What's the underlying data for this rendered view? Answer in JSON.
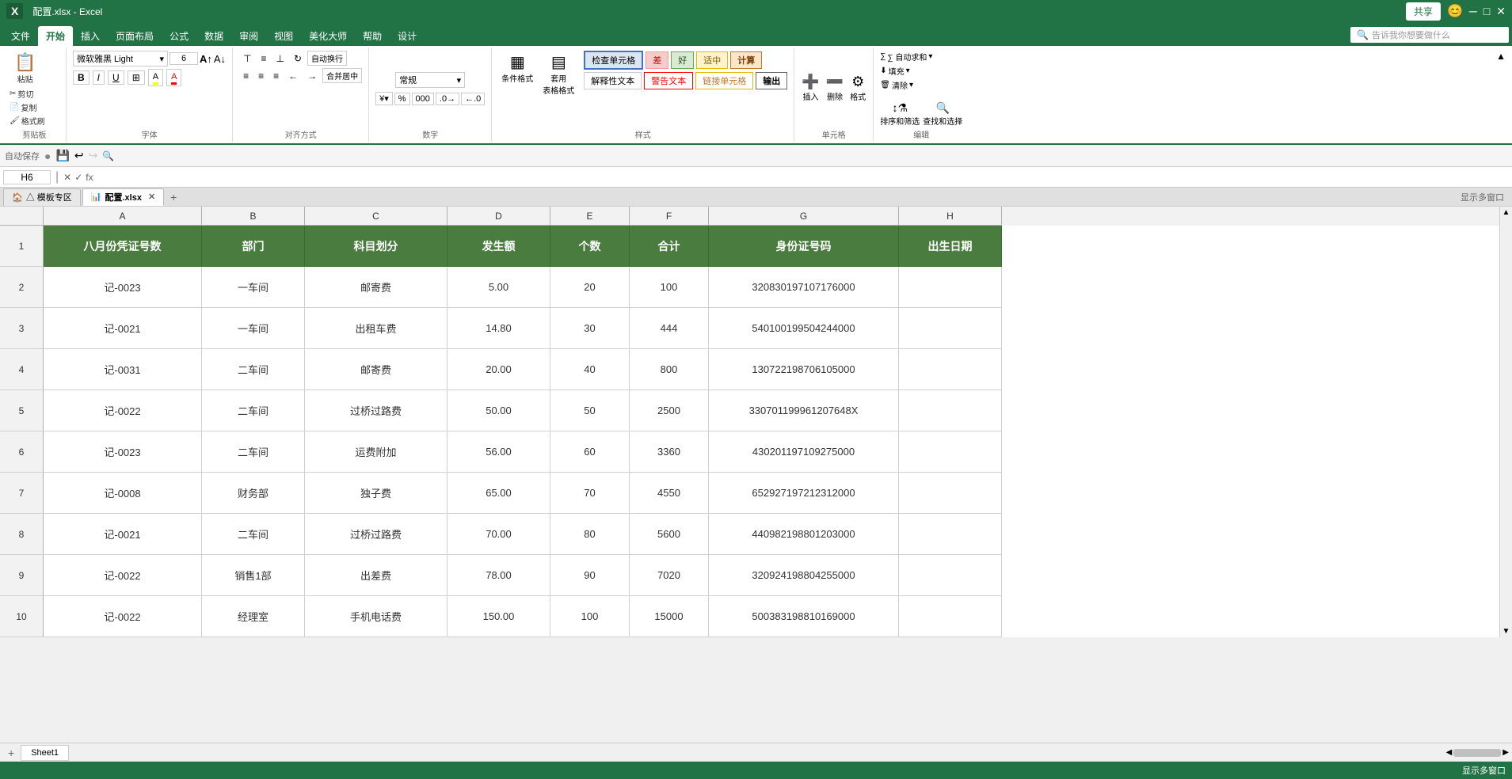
{
  "app": {
    "title": "配置.xlsx - Excel",
    "share_label": "共享",
    "emoji": "😊"
  },
  "ribbon_tabs": [
    {
      "label": "文件",
      "active": false
    },
    {
      "label": "开始",
      "active": true
    },
    {
      "label": "插入",
      "active": false
    },
    {
      "label": "页面布局",
      "active": false
    },
    {
      "label": "公式",
      "active": false
    },
    {
      "label": "数据",
      "active": false
    },
    {
      "label": "审阅",
      "active": false
    },
    {
      "label": "视图",
      "active": false
    },
    {
      "label": "美化大师",
      "active": false
    },
    {
      "label": "帮助",
      "active": false
    },
    {
      "label": "设计",
      "active": false
    }
  ],
  "search_placeholder": "告诉我你想要做什么",
  "quick_access": {
    "autosave_label": "自动保存",
    "autosave_off": "●"
  },
  "font": {
    "name": "微软雅黑 Light",
    "size": "6",
    "bold": "B",
    "italic": "I",
    "underline": "U"
  },
  "cell_ref": "H6",
  "formula_content": "",
  "file_tabs": [
    {
      "label": "△ 模板专区",
      "active": false,
      "icon": "🏠"
    },
    {
      "label": "配置.xlsx",
      "active": true,
      "icon": "📊",
      "closeable": true
    }
  ],
  "columns": [
    {
      "label": "A",
      "class": "col-a"
    },
    {
      "label": "B",
      "class": "col-b"
    },
    {
      "label": "C",
      "class": "col-c"
    },
    {
      "label": "D",
      "class": "col-d"
    },
    {
      "label": "E",
      "class": "col-e"
    },
    {
      "label": "F",
      "class": "col-f"
    },
    {
      "label": "G",
      "class": "col-g"
    },
    {
      "label": "H",
      "class": "col-h"
    }
  ],
  "rows": [
    {
      "row_num": "1",
      "height_class": "row-1",
      "is_header": true,
      "cells": [
        {
          "value": "八月份凭证号数",
          "class": "col-a header-row"
        },
        {
          "value": "部门",
          "class": "col-b header-row"
        },
        {
          "value": "科目划分",
          "class": "col-c header-row"
        },
        {
          "value": "发生额",
          "class": "col-d header-row"
        },
        {
          "value": "个数",
          "class": "col-e header-row"
        },
        {
          "value": "合计",
          "class": "col-f header-row"
        },
        {
          "value": "身份证号码",
          "class": "col-g header-row"
        },
        {
          "value": "出生日期",
          "class": "col-h header-row"
        }
      ]
    },
    {
      "row_num": "2",
      "height_class": "row-n",
      "cells": [
        {
          "value": "记-0023",
          "class": "col-a"
        },
        {
          "value": "一车间",
          "class": "col-b"
        },
        {
          "value": "邮寄费",
          "class": "col-c"
        },
        {
          "value": "5.00",
          "class": "col-d"
        },
        {
          "value": "20",
          "class": "col-e"
        },
        {
          "value": "100",
          "class": "col-f"
        },
        {
          "value": "320830197107176000",
          "class": "col-g"
        },
        {
          "value": "",
          "class": "col-h"
        }
      ]
    },
    {
      "row_num": "3",
      "height_class": "row-n",
      "cells": [
        {
          "value": "记-0021",
          "class": "col-a"
        },
        {
          "value": "一车间",
          "class": "col-b"
        },
        {
          "value": "出租车费",
          "class": "col-c"
        },
        {
          "value": "14.80",
          "class": "col-d"
        },
        {
          "value": "30",
          "class": "col-e"
        },
        {
          "value": "444",
          "class": "col-f"
        },
        {
          "value": "540100199504244000",
          "class": "col-g"
        },
        {
          "value": "",
          "class": "col-h"
        }
      ]
    },
    {
      "row_num": "4",
      "height_class": "row-n",
      "cells": [
        {
          "value": "记-0031",
          "class": "col-a"
        },
        {
          "value": "二车间",
          "class": "col-b"
        },
        {
          "value": "邮寄费",
          "class": "col-c"
        },
        {
          "value": "20.00",
          "class": "col-d"
        },
        {
          "value": "40",
          "class": "col-e"
        },
        {
          "value": "800",
          "class": "col-f"
        },
        {
          "value": "130722198706105000",
          "class": "col-g"
        },
        {
          "value": "",
          "class": "col-h"
        }
      ]
    },
    {
      "row_num": "5",
      "height_class": "row-n",
      "cells": [
        {
          "value": "记-0022",
          "class": "col-a"
        },
        {
          "value": "二车间",
          "class": "col-b"
        },
        {
          "value": "过桥过路费",
          "class": "col-c"
        },
        {
          "value": "50.00",
          "class": "col-d"
        },
        {
          "value": "50",
          "class": "col-e"
        },
        {
          "value": "2500",
          "class": "col-f"
        },
        {
          "value": "330701199961207648X",
          "class": "col-g"
        },
        {
          "value": "",
          "class": "col-h"
        }
      ]
    },
    {
      "row_num": "6",
      "height_class": "row-n",
      "cells": [
        {
          "value": "记-0023",
          "class": "col-a"
        },
        {
          "value": "二车间",
          "class": "col-b"
        },
        {
          "value": "运费附加",
          "class": "col-c"
        },
        {
          "value": "56.00",
          "class": "col-d"
        },
        {
          "value": "60",
          "class": "col-e"
        },
        {
          "value": "3360",
          "class": "col-f"
        },
        {
          "value": "430201197109275000",
          "class": "col-g"
        },
        {
          "value": "",
          "class": "col-h selected"
        }
      ]
    },
    {
      "row_num": "7",
      "height_class": "row-n",
      "cells": [
        {
          "value": "记-0008",
          "class": "col-a"
        },
        {
          "value": "财务部",
          "class": "col-b"
        },
        {
          "value": "独子费",
          "class": "col-c"
        },
        {
          "value": "65.00",
          "class": "col-d"
        },
        {
          "value": "70",
          "class": "col-e"
        },
        {
          "value": "4550",
          "class": "col-f"
        },
        {
          "value": "652927197212312000",
          "class": "col-g"
        },
        {
          "value": "",
          "class": "col-h"
        }
      ]
    },
    {
      "row_num": "8",
      "height_class": "row-n",
      "cells": [
        {
          "value": "记-0021",
          "class": "col-a"
        },
        {
          "value": "二车间",
          "class": "col-b"
        },
        {
          "value": "过桥过路费",
          "class": "col-c"
        },
        {
          "value": "70.00",
          "class": "col-d"
        },
        {
          "value": "80",
          "class": "col-e"
        },
        {
          "value": "5600",
          "class": "col-f"
        },
        {
          "value": "440982198801203000",
          "class": "col-g"
        },
        {
          "value": "",
          "class": "col-h"
        }
      ]
    },
    {
      "row_num": "9",
      "height_class": "row-n",
      "cells": [
        {
          "value": "记-0022",
          "class": "col-a"
        },
        {
          "value": "销售1部",
          "class": "col-b"
        },
        {
          "value": "出差费",
          "class": "col-c"
        },
        {
          "value": "78.00",
          "class": "col-d"
        },
        {
          "value": "90",
          "class": "col-e"
        },
        {
          "value": "7020",
          "class": "col-f"
        },
        {
          "value": "320924198804255000",
          "class": "col-g"
        },
        {
          "value": "",
          "class": "col-h"
        }
      ]
    },
    {
      "row_num": "10",
      "height_class": "row-n",
      "cells": [
        {
          "value": "记-0022",
          "class": "col-a"
        },
        {
          "value": "经理室",
          "class": "col-b"
        },
        {
          "value": "手机电话费",
          "class": "col-c"
        },
        {
          "value": "150.00",
          "class": "col-d"
        },
        {
          "value": "100",
          "class": "col-e"
        },
        {
          "value": "15000",
          "class": "col-f"
        },
        {
          "value": "500383198810169000",
          "class": "col-g"
        },
        {
          "value": "",
          "class": "col-h"
        }
      ]
    }
  ],
  "sheet_tabs": [
    {
      "label": "Sheet1",
      "active": true
    }
  ],
  "status": {
    "left": "",
    "right": "显示多窗口"
  },
  "styles": [
    {
      "label": "差",
      "bg": "#f4cccc",
      "color": "#cc0000"
    },
    {
      "label": "好",
      "bg": "#d9ead3",
      "color": "#274e13"
    },
    {
      "label": "适中",
      "bg": "#fff2cc",
      "color": "#7f6000"
    },
    {
      "label": "计算",
      "bg": "#fce5cd",
      "color": "#783f04"
    }
  ],
  "ribbon": {
    "clipboard_label": "剪贴板",
    "font_label": "字体",
    "alignment_label": "对齐方式",
    "number_label": "数字",
    "styles_label": "样式",
    "cells_label": "单元格",
    "editing_label": "编辑",
    "cut": "✂ 剪切",
    "copy": "📋 复制",
    "paste": "粘贴",
    "format_painter": "格式刷",
    "conditional_format": "条件格式",
    "table_format": "套用\n表格格式",
    "check_cell": "检查单元格",
    "explain_text": "解释性文本",
    "warn_text": "警告文本",
    "link_cell": "链接单元格",
    "output": "输出",
    "insert": "插入",
    "delete": "删除",
    "format": "格式",
    "sort_filter": "排序和筛选",
    "find_select": "查找和选择",
    "auto_sum": "∑ 自动求和",
    "fill": "填充",
    "clear": "清除",
    "autorun": "自动换行",
    "merge_center": "合并居中"
  }
}
